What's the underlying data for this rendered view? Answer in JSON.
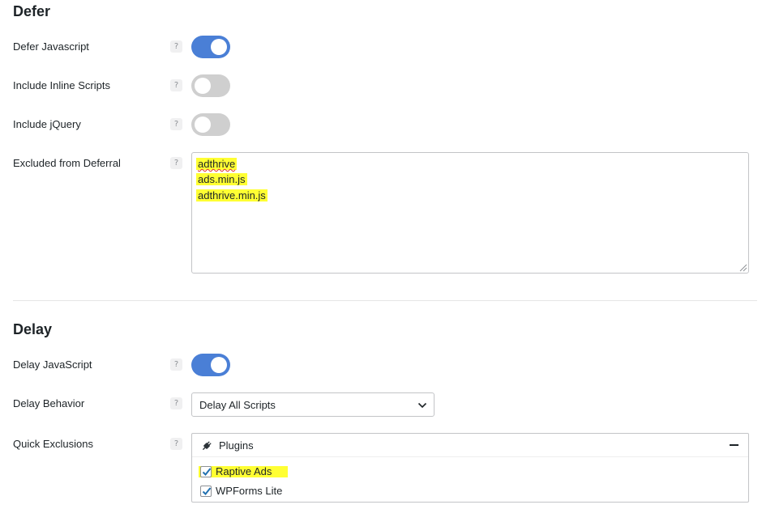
{
  "defer": {
    "title": "Defer",
    "defer_js": {
      "label": "Defer Javascript",
      "help": "?",
      "on": true
    },
    "inline_scripts": {
      "label": "Include Inline Scripts",
      "help": "?",
      "on": false
    },
    "include_jquery": {
      "label": "Include jQuery",
      "help": "?",
      "on": false
    },
    "excluded": {
      "label": "Excluded from Deferral",
      "help": "?",
      "lines": [
        "adthrive",
        "ads.min.js",
        "adthrive.min.js"
      ]
    }
  },
  "delay": {
    "title": "Delay",
    "delay_js": {
      "label": "Delay JavaScript",
      "help": "?",
      "on": true
    },
    "behavior": {
      "label": "Delay Behavior",
      "help": "?",
      "selected": "Delay All Scripts"
    },
    "quick_exclusions": {
      "label": "Quick Exclusions",
      "help": "?",
      "group_title": "Plugins",
      "items": [
        {
          "label": "Raptive Ads",
          "checked": true
        },
        {
          "label": "WPForms Lite",
          "checked": true
        }
      ]
    }
  },
  "colors": {
    "toggle_on": "#4a7fd6",
    "toggle_off": "#cfcfcf",
    "highlight": "#ffff33"
  },
  "icons": {
    "help": "question-mark-icon",
    "plugins": "plug-icon",
    "collapse": "minus-icon",
    "select": "chevron-down-icon",
    "check": "checkmark-icon"
  }
}
